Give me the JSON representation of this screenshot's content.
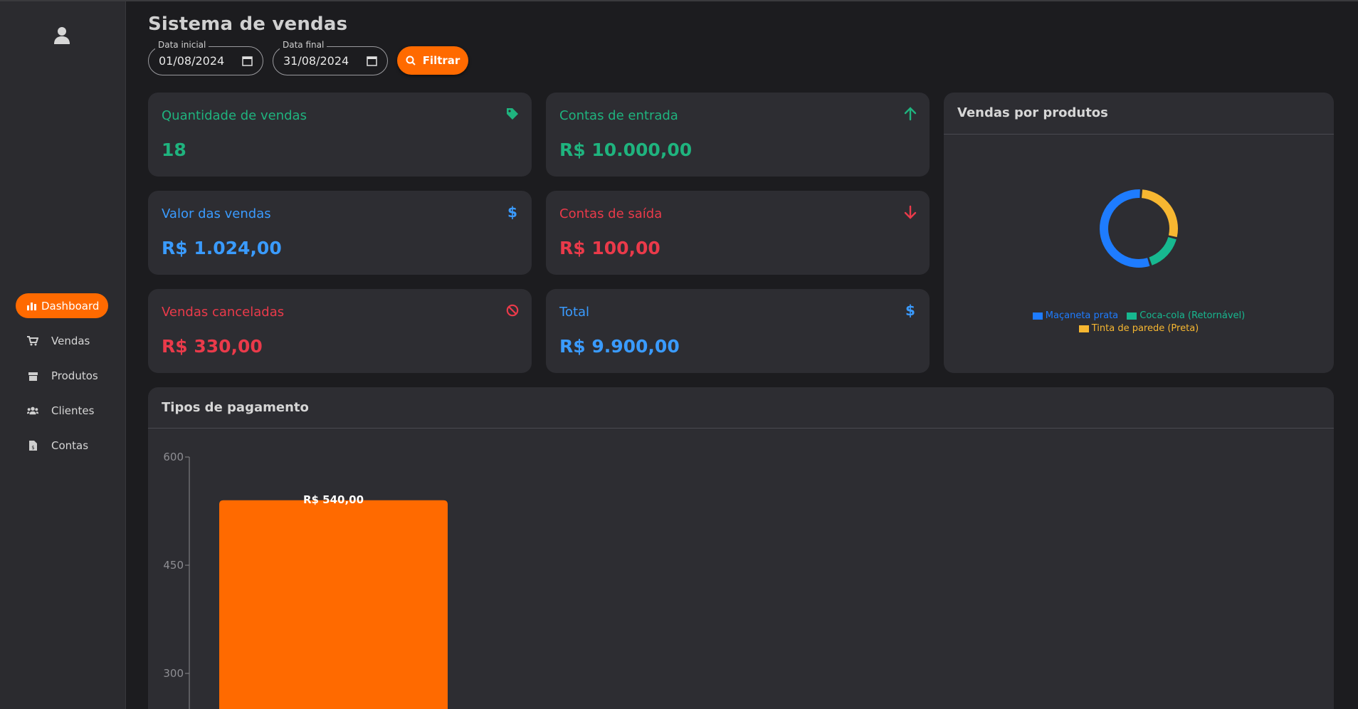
{
  "sidebar": {
    "items": [
      {
        "label": "Dashboard",
        "icon": "bar-chart-icon",
        "active": true
      },
      {
        "label": "Vendas",
        "icon": "cart-icon"
      },
      {
        "label": "Produtos",
        "icon": "box-icon"
      },
      {
        "label": "Clientes",
        "icon": "users-icon"
      },
      {
        "label": "Contas",
        "icon": "invoice-icon"
      }
    ]
  },
  "header": {
    "title": "Sistema de vendas",
    "start_label": "Data inicial",
    "start_value": "01/08/2024",
    "end_label": "Data final",
    "end_value": "31/08/2024",
    "filter_label": "Filtrar"
  },
  "cards": {
    "qty": {
      "label": "Quantidade de vendas",
      "value": "18",
      "icon": "tag-icon"
    },
    "inflow": {
      "label": "Contas de entrada",
      "value": "R$ 10.000,00",
      "icon": "arrow-up-icon"
    },
    "sales_value": {
      "label": "Valor das vendas",
      "value": "R$ 1.024,00",
      "icon": "dollar-icon"
    },
    "outflow": {
      "label": "Contas de saída",
      "value": "R$ 100,00",
      "icon": "arrow-down-icon"
    },
    "canceled": {
      "label": "Vendas canceladas",
      "value": "R$ 330,00",
      "icon": "ban-icon"
    },
    "total": {
      "label": "Total",
      "value": "R$ 9.900,00",
      "icon": "dollar-icon"
    }
  },
  "colors": {
    "accent": "#ff6a00",
    "green": "#1fb37e",
    "blue": "#3a9bff",
    "red": "#ea3a4a",
    "yellow": "#f7b731",
    "teal": "#17b890"
  },
  "products_panel": {
    "title": "Vendas por produtos"
  },
  "payments_panel": {
    "title": "Tipos de pagamento"
  },
  "chart_data": [
    {
      "type": "pie",
      "title": "Vendas por produtos",
      "categories": [
        "Maçaneta prata",
        "Coca-cola (Retornável)",
        "Tinta de parede (Preta)"
      ],
      "values": [
        56,
        16,
        28
      ],
      "colors": [
        "#1e7cff",
        "#17b890",
        "#f7b731"
      ],
      "legend": "bottom"
    },
    {
      "type": "bar",
      "title": "Tipos de pagamento",
      "categories": [
        ""
      ],
      "values": [
        540
      ],
      "data_labels": [
        "R$ 540,00"
      ],
      "yticks": [
        300,
        450,
        600
      ],
      "ylim": [
        0,
        600
      ],
      "color": "#ff6a00"
    }
  ]
}
